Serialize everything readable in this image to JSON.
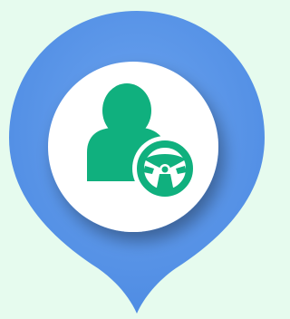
{
  "marker": {
    "icon": "driver-location-pin-icon",
    "colors": {
      "background": "#e6fbee",
      "pin": "#5a96e8",
      "pin_shadow": "#3f7fd9",
      "disc": "#ffffff",
      "person": "#10b07e",
      "wheel": "#10b07e"
    },
    "inner_icons": [
      "person-icon",
      "steering-wheel-icon"
    ]
  }
}
